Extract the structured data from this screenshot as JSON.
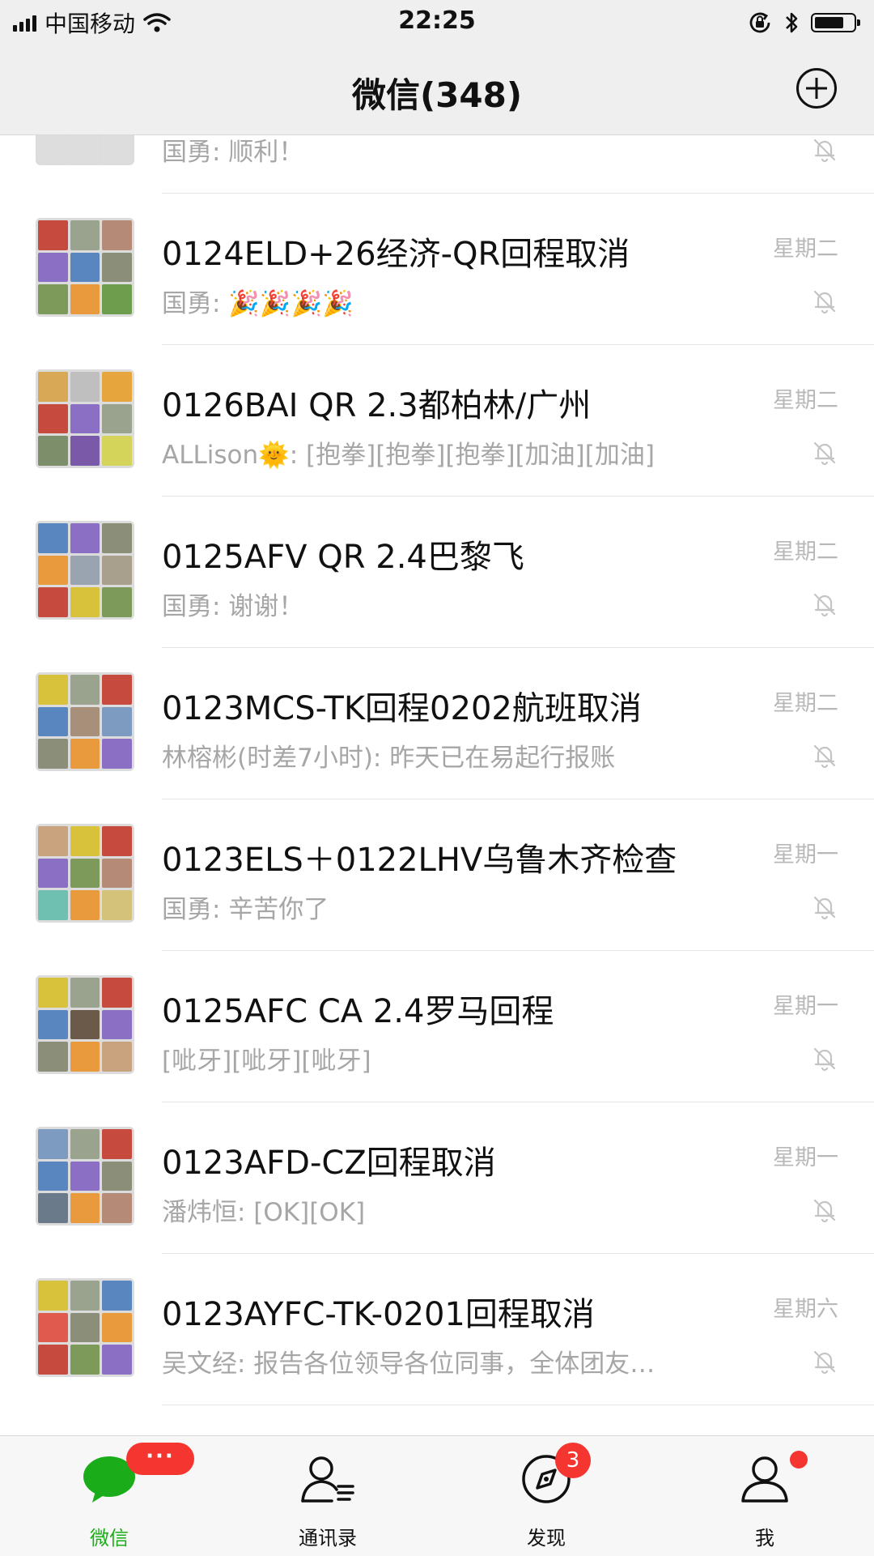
{
  "status_bar": {
    "carrier": "中国移动",
    "time": "22:25",
    "battery_level": 0.75
  },
  "nav": {
    "title": "微信(348)",
    "plus_icon": "plus-circle-icon"
  },
  "chats": [
    {
      "name": "",
      "preview": "国勇: 顺利！",
      "time": "",
      "muted": true,
      "avatar_colors": [
        "#b89467",
        "#c9a27e",
        "#6f8fb0",
        "#8a7f6a",
        "#8d6bb8",
        "#e05a4e",
        "#ddd",
        "#ddd",
        "#ddd"
      ]
    },
    {
      "name": "0124ELD+26经济-QR回程取消",
      "preview": "国勇: 🎉🎉🎉🎉",
      "time": "星期二",
      "muted": true,
      "avatar_colors": [
        "#c74a3f",
        "#9aa38d",
        "#b58b78",
        "#8b6fc4",
        "#5a86c0",
        "#8b8f7a",
        "#7d9a5a",
        "#e89a3c",
        "#6f9d4e"
      ]
    },
    {
      "name": "0126BAI QR 2.3都柏林/广州",
      "preview": "ALLison🌞: [抱拳][抱拳][抱拳][加油][加油]",
      "time": "星期二",
      "muted": true,
      "avatar_colors": [
        "#d9a857",
        "#bfbfbf",
        "#e6a53d",
        "#c74a3f",
        "#8b6fc4",
        "#9aa38d",
        "#7d8f6a",
        "#7a5aa8",
        "#d4d45a"
      ]
    },
    {
      "name": "0125AFV QR 2.4巴黎飞",
      "preview": "国勇: 谢谢！",
      "time": "星期二",
      "muted": true,
      "avatar_colors": [
        "#5a86c0",
        "#8b6fc4",
        "#8b8f7a",
        "#e89a3c",
        "#9aa3b0",
        "#a8a08d",
        "#c74a3f",
        "#d9c23b",
        "#7d9a5a"
      ]
    },
    {
      "name": "0123MCS-TK回程0202航班取消",
      "preview": "林榕彬(时差7小时): 昨天已在易起行报账",
      "time": "星期二",
      "muted": true,
      "avatar_colors": [
        "#d9c23b",
        "#9aa38d",
        "#c74a3f",
        "#5a86c0",
        "#a88f7a",
        "#7d9ac0",
        "#8b8f7a",
        "#e89a3c",
        "#8b6fc4"
      ]
    },
    {
      "name": "0123ELS＋0122LHV乌鲁木齐检查",
      "preview": "国勇: 辛苦你了",
      "time": "星期一",
      "muted": true,
      "avatar_colors": [
        "#c9a27e",
        "#d9c23b",
        "#c74a3f",
        "#8b6fc4",
        "#7d9a5a",
        "#b58b78",
        "#6fc0b0",
        "#e89a3c",
        "#d4c27a"
      ]
    },
    {
      "name": "0125AFC CA 2.4罗马回程",
      "preview": "[呲牙][呲牙][呲牙]",
      "time": "星期一",
      "muted": true,
      "avatar_colors": [
        "#d9c23b",
        "#9aa38d",
        "#c74a3f",
        "#5a86c0",
        "#6b5a4a",
        "#8b6fc4",
        "#8b8f7a",
        "#e89a3c",
        "#c9a27e"
      ]
    },
    {
      "name": "0123AFD-CZ回程取消",
      "preview": "潘炜恒: [OK][OK]",
      "time": "星期一",
      "muted": true,
      "avatar_colors": [
        "#7d9ac0",
        "#9aa38d",
        "#c74a3f",
        "#5a86c0",
        "#8b6fc4",
        "#8b8f7a",
        "#6b7a8a",
        "#e89a3c",
        "#b58b78"
      ]
    },
    {
      "name": "0123AYFC-TK-0201回程取消",
      "preview": "吴文经: 报告各位领导各位同事，全体团友…",
      "time": "星期六",
      "muted": true,
      "avatar_colors": [
        "#d9c23b",
        "#9aa38d",
        "#5a86c0",
        "#e05a4e",
        "#8b8f7a",
        "#e89a3c",
        "#c74a3f",
        "#7d9a5a",
        "#8b6fc4"
      ]
    }
  ],
  "tabs": [
    {
      "label": "微信",
      "icon": "chat-bubble-icon",
      "active": true,
      "badge": "···"
    },
    {
      "label": "通讯录",
      "icon": "contacts-icon",
      "active": false
    },
    {
      "label": "发现",
      "icon": "compass-icon",
      "active": false,
      "badge": "3"
    },
    {
      "label": "我",
      "icon": "person-icon",
      "active": false,
      "badge_dot": true
    }
  ],
  "colors": {
    "accent": "#1aad19",
    "badge": "#f43530",
    "secondary_text": "#a6a6a6"
  }
}
